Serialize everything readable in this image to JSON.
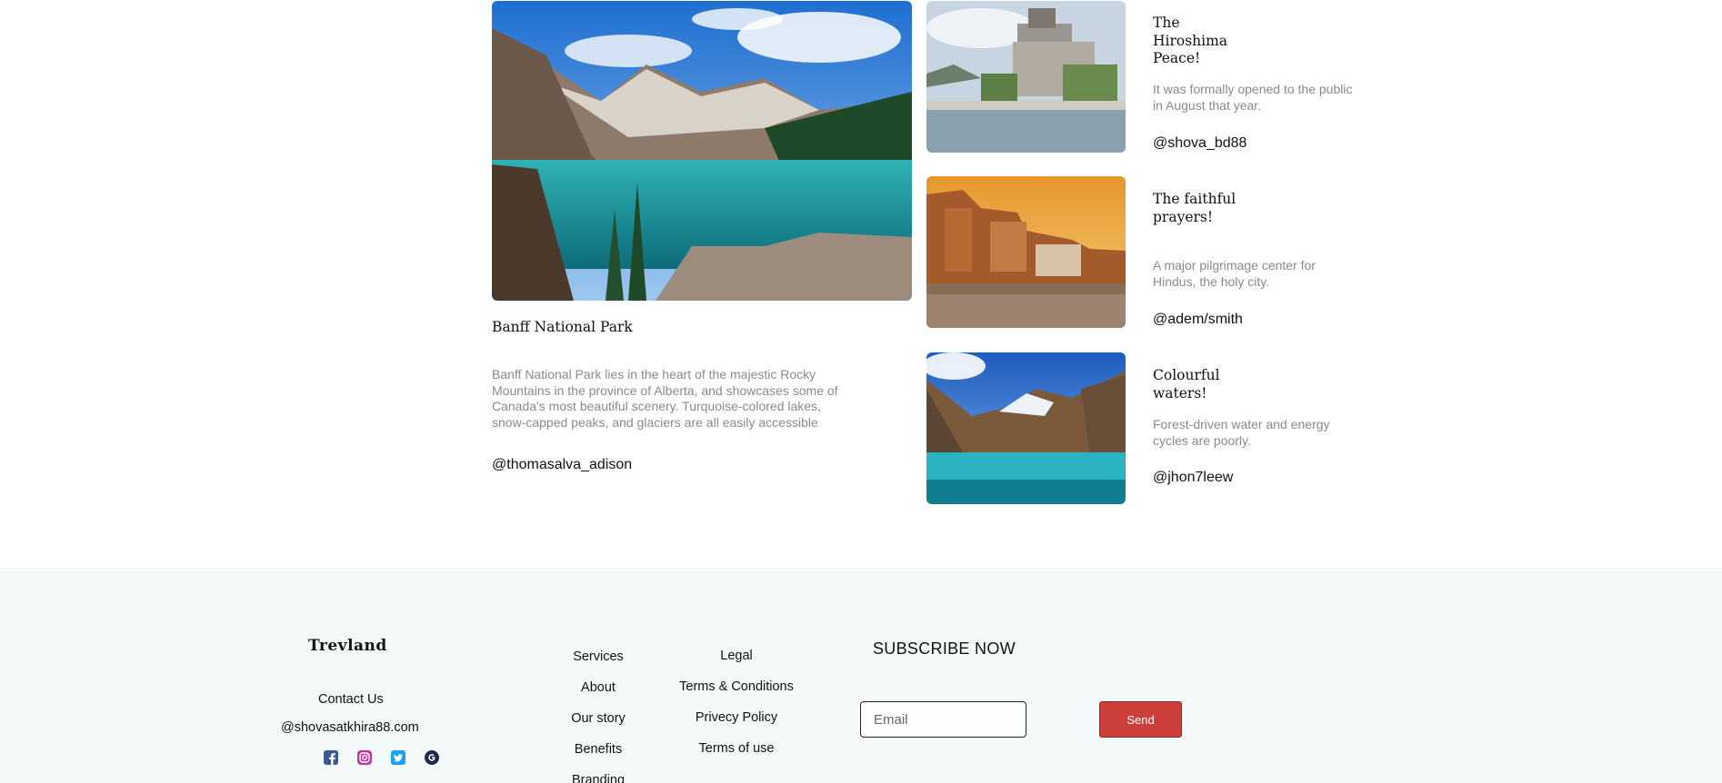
{
  "feature": {
    "title": "Banff National Park",
    "description": "Banff National Park lies in the heart of the majestic Rocky Mountains in the province of Alberta, and showcases some of Canada's most beautiful scenery. Turquoise-colored lakes, snow-capped peaks, and glaciers are all easily accessible",
    "handle": "@thomasalva_adison"
  },
  "cards": [
    {
      "title": "The Hiroshima Peace!",
      "description": "It was formally opened to the public in August that year.",
      "handle": "@shova_bd88"
    },
    {
      "title": "The faithful prayers!",
      "description": "A major pilgrimage center for Hindus, the holy city.",
      "handle": "@adem/smith"
    },
    {
      "title": "Colourful waters!",
      "description": "Forest-driven water and energy cycles are poorly.",
      "handle": "@jhon7leew"
    }
  ],
  "footer": {
    "brand": "Trevland",
    "contact_label": "Contact Us",
    "email": "@shovasatkhira88.com",
    "social_icons": [
      "facebook-icon",
      "instagram-icon",
      "twitter-icon",
      "google-icon"
    ],
    "nav_primary": [
      "Services",
      "About",
      "Our story",
      "Benefits",
      "Branding"
    ],
    "nav_secondary": [
      "Legal",
      "Terms & Conditions",
      "Privecy Policy",
      "Terms of use"
    ],
    "subscribe": {
      "title": "SUBSCRIBE NOW",
      "placeholder": "Email",
      "button_label": "Send"
    }
  },
  "colors": {
    "footer_bg": "#f4fafa",
    "send_button": "#cc3f3a",
    "muted_text": "#8a8a8a"
  }
}
